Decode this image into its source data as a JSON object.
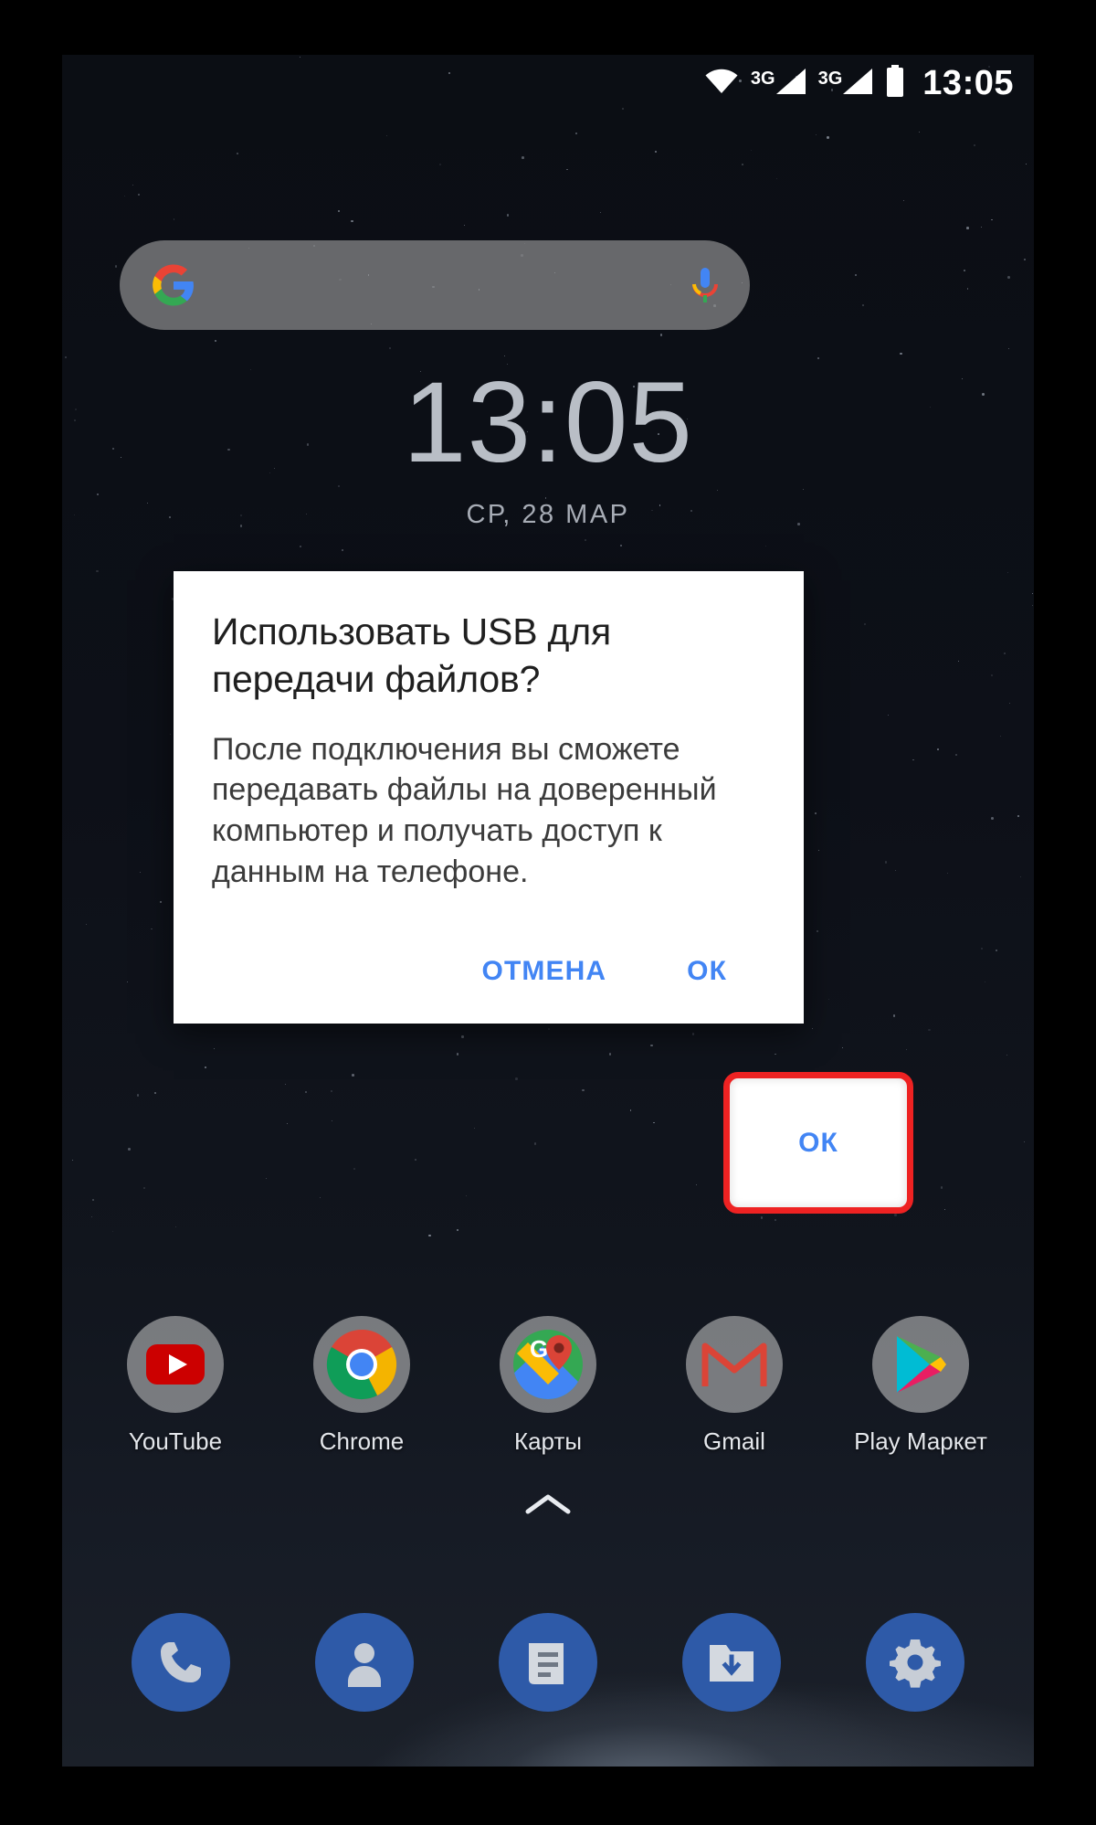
{
  "status_bar": {
    "wifi_icon": "wifi-icon",
    "signal_1": {
      "label": "3G",
      "icon": "signal-bars-icon"
    },
    "signal_2": {
      "label": "3G",
      "icon": "signal-bars-icon"
    },
    "battery_icon": "battery-full-icon",
    "time": "13:05"
  },
  "search": {
    "google_logo": "google-g-icon",
    "mic_icon": "microphone-icon",
    "placeholder": ""
  },
  "clock_widget": {
    "time": "13:05",
    "date": "СР, 28 МАР"
  },
  "apps": [
    {
      "label": "YouTube",
      "icon": "youtube-icon"
    },
    {
      "label": "Chrome",
      "icon": "chrome-icon"
    },
    {
      "label": "Карты",
      "icon": "google-maps-icon"
    },
    {
      "label": "Gmail",
      "icon": "gmail-icon"
    },
    {
      "label": "Play Маркет",
      "icon": "play-store-icon"
    }
  ],
  "drawer": {
    "chevron_icon": "chevron-up-icon"
  },
  "dock": [
    {
      "name": "phone",
      "icon": "phone-icon"
    },
    {
      "name": "contacts",
      "icon": "person-icon"
    },
    {
      "name": "messages",
      "icon": "message-document-icon"
    },
    {
      "name": "downloads",
      "icon": "folder-download-icon"
    },
    {
      "name": "settings",
      "icon": "gear-icon"
    }
  ],
  "dialog": {
    "title": "Использовать USB для передачи файлов?",
    "message": "После подключения вы сможете передавать файлы на доверенный компьютер и получать доступ к данным на телефоне.",
    "cancel_label": "ОТМЕНА",
    "ok_label": "ОК"
  },
  "colors": {
    "accent_blue": "#4285f4",
    "highlight_red": "#ee2222",
    "dock_blue": "#2e5aa8",
    "dialog_bg": "#ffffff"
  }
}
